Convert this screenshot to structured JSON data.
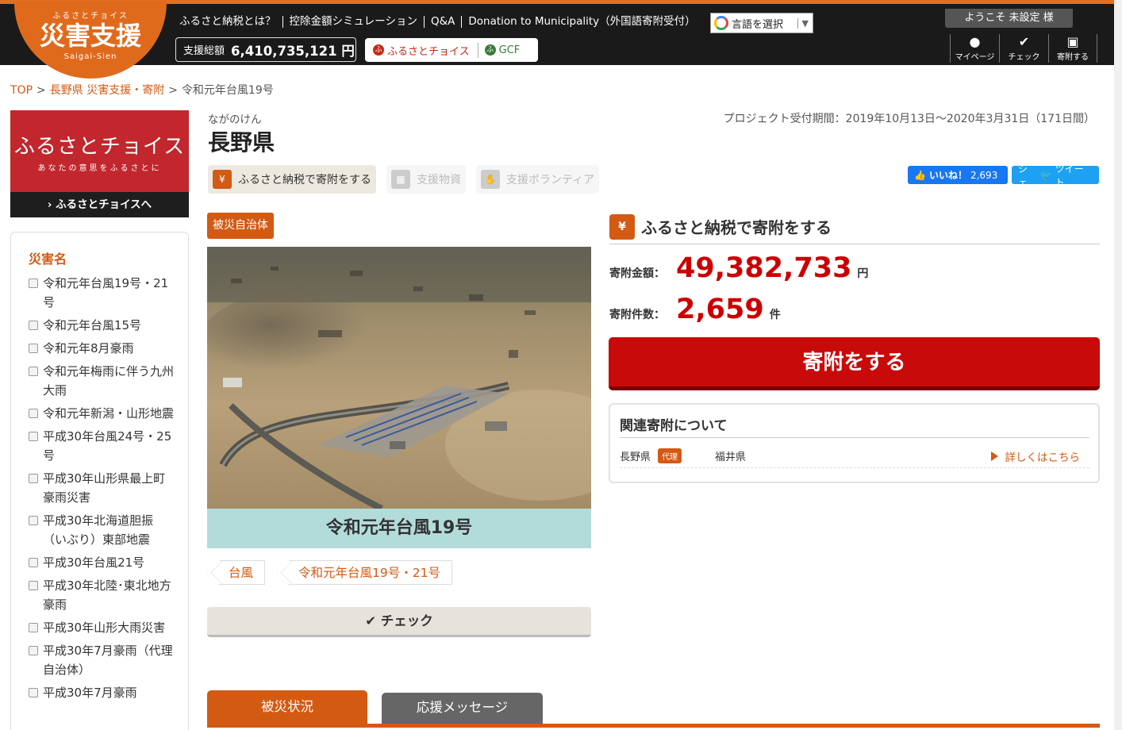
{
  "header": {
    "logo_small": "ふるさとチョイス",
    "logo_main": "災害支援",
    "logo_roman": "Saigai-Sien",
    "nav": [
      "ふるさと納税とは？",
      "控除金額シミュレーション",
      "Q&A",
      "Donation to Municipality（外国語寄附受付）"
    ],
    "language_select": "言語を選択",
    "total_label": "支援総額",
    "total_value": "6,410,735,121 円",
    "partner_choice": "ふるさとチョイス",
    "partner_gcf": "GCF",
    "welcome": "ようこそ 未設定 様",
    "user_menu": [
      {
        "label": "マイページ",
        "icon": "user-icon"
      },
      {
        "label": "チェック",
        "icon": "check-icon"
      },
      {
        "label": "寄附する",
        "icon": "donate-box-icon"
      }
    ]
  },
  "breadcrumb": [
    "TOP",
    "長野県 災害支援・寄附",
    "令和元年台風19号"
  ],
  "sidebar": {
    "banner_title": "ふるさとチョイス",
    "banner_sub": "あなたの意思をふるさとに",
    "banner_link": "ふるさとチョイスへ",
    "filter_heading": "災害名",
    "disasters": [
      "令和元年台風19号・21号",
      "令和元年台風15号",
      "令和元年8月豪雨",
      "令和元年梅雨に伴う九州大雨",
      "令和元年新潟・山形地震",
      "平成30年台風24号・25号",
      "平成30年山形県最上町豪雨災害",
      "平成30年北海道胆振（いぶり）東部地震",
      "平成30年台風21号",
      "平成30年北陸･東北地方豪雨",
      "平成30年山形大雨災害",
      "平成30年7月豪雨（代理自治体）",
      "平成30年7月豪雨"
    ]
  },
  "project": {
    "furigana": "ながのけん",
    "prefecture": "長野県",
    "period": "プロジェクト受付期間：2019年10月13日～2020年3月31日（171日間）",
    "subnav": [
      "ふるさと納税で寄附をする",
      "支援物資",
      "支援ボランティア"
    ],
    "like_label": "いいね！",
    "like_count": "2,693",
    "share_label": "シェ",
    "tweet_label": "ツイート",
    "badge": "被災自治体",
    "photo_alt": "aerial-flood-photo",
    "caption": "令和元年台風19号",
    "tags": [
      "台風",
      "令和元年台風19号・21号"
    ],
    "check_button": "チェック",
    "tabs": [
      "被災状況",
      "応援メッセージ"
    ]
  },
  "donation": {
    "title": "ふるさと納税で寄附をする",
    "amount_label": "寄附金額：",
    "amount_value": "49,382,733",
    "amount_unit": "円",
    "count_label": "寄附件数：",
    "count_value": "2,659",
    "count_unit": "件",
    "button": "寄附をする",
    "related_title": "関連寄附について",
    "related_main": "長野県",
    "related_tag": "代理",
    "related_proxy": "福井県",
    "related_more": "詳しくはこちら"
  },
  "colors": {
    "accent": "#d35a12",
    "donate_red": "#c80a0a",
    "amount_red": "#cc0000",
    "header_bg": "#1a1a1a"
  }
}
